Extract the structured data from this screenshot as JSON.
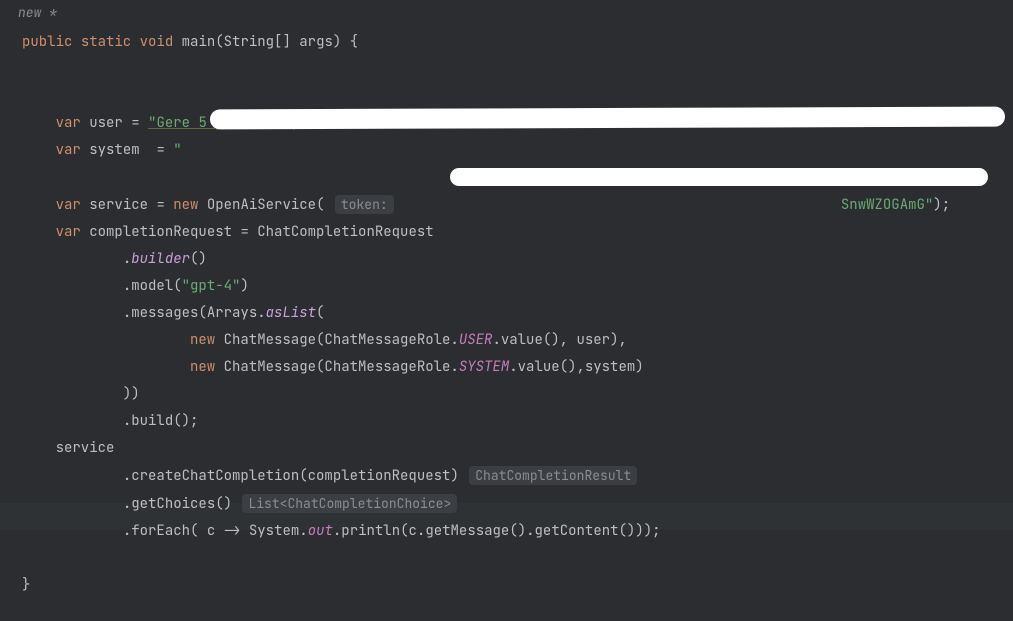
{
  "tab": {
    "label": "new *"
  },
  "code": {
    "kw_public": "public",
    "kw_static": "static",
    "kw_void": "void",
    "fn_main": "main",
    "type_string_arr": "String[]",
    "param_args": "args",
    "kw_var1": "var",
    "id_user": "user",
    "str_user": "\"Gere 5 produtos\"",
    "kw_var2": "var",
    "id_system": "system",
    "str_system_open": "\"",
    "kw_var3": "var",
    "id_service": "service",
    "kw_new1": "new",
    "cls_openai": "OpenAiService",
    "hint_token": "token:",
    "trail_after_token": "SnwWZOGAmG\"",
    "kw_var4": "var",
    "id_compreq": "completionRequest",
    "cls_chatreq": "ChatCompletionRequest",
    "m_builder": "builder",
    "m_model": "model",
    "str_model": "\"gpt-4\"",
    "m_messages": "messages",
    "cls_arrays": "Arrays",
    "m_asList": "asList",
    "kw_new2": "new",
    "cls_chatmsg1": "ChatMessage",
    "cls_role1": "ChatMessageRole",
    "fld_user": "USER",
    "m_value1": "value",
    "arg_user": "user",
    "kw_new3": "new",
    "cls_chatmsg2": "ChatMessage",
    "cls_role2": "ChatMessageRole",
    "fld_system": "SYSTEM",
    "m_value2": "value",
    "arg_system": "system",
    "m_build": "build",
    "id_service2": "service",
    "m_create": "createChatCompletion",
    "arg_compreq": "completionRequest",
    "hint_result": "ChatCompletionResult",
    "m_getChoices": "getChoices",
    "hint_list": "List<ChatCompletionChoice>",
    "m_forEach": "forEach",
    "lambda_c": "c",
    "arrow": "->",
    "cls_system": "System",
    "fld_out": "out",
    "m_println": "println",
    "m_getMessage": "getMessage",
    "m_getContent": "getContent"
  }
}
